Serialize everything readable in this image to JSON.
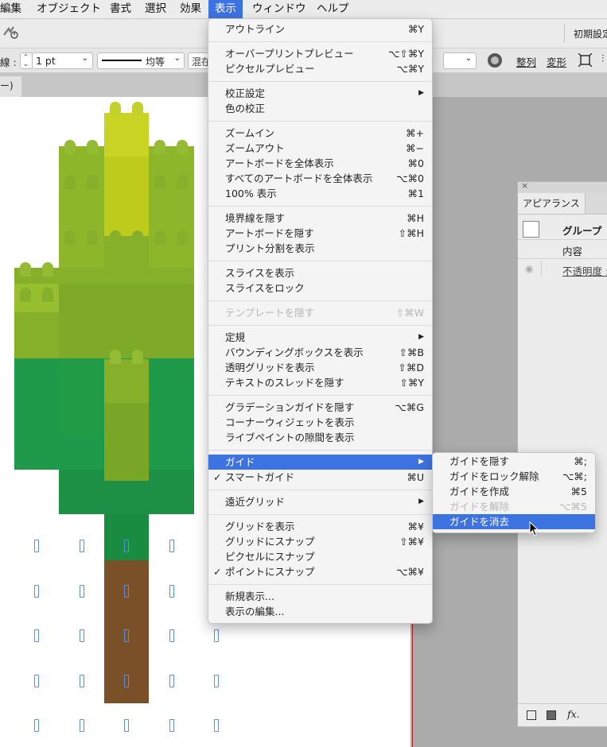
{
  "menubar": {
    "items": [
      "編集",
      "オブジェクト",
      "書式",
      "選択",
      "効果",
      "表示",
      "ウィンドウ",
      "ヘルプ"
    ],
    "active": "表示"
  },
  "toolbar": {
    "workspace_label": "初期設定",
    "stroke_label": "線 :",
    "stroke_weight": "1 pt",
    "stroke_profile": "均等",
    "blend_label": "混在",
    "align_label": "整列",
    "transform_label": "変形"
  },
  "tab": {
    "label": "ー)"
  },
  "appearance_panel": {
    "tab_label": "アピアランス",
    "group_label": "グループ",
    "content_label": "内容",
    "opacity_label": "不透明度 :",
    "fx_label": "fx."
  },
  "view_menu": {
    "items": [
      {
        "label": "アウトライン",
        "shortcut": "⌘Y"
      },
      {
        "sep": true
      },
      {
        "label": "オーバープリントプレビュー",
        "shortcut": "⌥⇧⌘Y"
      },
      {
        "label": "ピクセルプレビュー",
        "shortcut": "⌥⌘Y"
      },
      {
        "sep": true
      },
      {
        "label": "校正設定",
        "submenu": true
      },
      {
        "label": "色の校正",
        "shortcut": ""
      },
      {
        "sep": true
      },
      {
        "label": "ズームイン",
        "shortcut": "⌘+"
      },
      {
        "label": "ズームアウト",
        "shortcut": "⌘−"
      },
      {
        "label": "アートボードを全体表示",
        "shortcut": "⌘0"
      },
      {
        "label": "すべてのアートボードを全体表示",
        "shortcut": "⌥⌘0"
      },
      {
        "label": "100% 表示",
        "shortcut": "⌘1"
      },
      {
        "sep": true
      },
      {
        "label": "境界線を隠す",
        "shortcut": "⌘H"
      },
      {
        "label": "アートボードを隠す",
        "shortcut": "⇧⌘H"
      },
      {
        "label": "プリント分割を表示",
        "shortcut": ""
      },
      {
        "sep": true
      },
      {
        "label": "スライスを表示",
        "shortcut": ""
      },
      {
        "label": "スライスをロック",
        "shortcut": ""
      },
      {
        "sep": true
      },
      {
        "label": "テンプレートを隠す",
        "shortcut": "⇧⌘W",
        "disabled": true
      },
      {
        "sep": true
      },
      {
        "label": "定規",
        "submenu": true
      },
      {
        "label": "バウンディングボックスを表示",
        "shortcut": "⇧⌘B"
      },
      {
        "label": "透明グリッドを表示",
        "shortcut": "⇧⌘D"
      },
      {
        "label": "テキストのスレッドを隠す",
        "shortcut": "⇧⌘Y"
      },
      {
        "sep": true
      },
      {
        "label": "グラデーションガイドを隠す",
        "shortcut": "⌥⌘G"
      },
      {
        "label": "コーナーウィジェットを表示",
        "shortcut": ""
      },
      {
        "label": "ライブペイントの隙間を表示",
        "shortcut": ""
      },
      {
        "sep": true
      },
      {
        "label": "ガイド",
        "submenu": true,
        "highlighted": true
      },
      {
        "label": "スマートガイド",
        "shortcut": "⌘U",
        "checked": true
      },
      {
        "sep": true
      },
      {
        "label": "遠近グリッド",
        "submenu": true
      },
      {
        "sep": true
      },
      {
        "label": "グリッドを表示",
        "shortcut": "⌘¥"
      },
      {
        "label": "グリッドにスナップ",
        "shortcut": "⇧⌘¥"
      },
      {
        "label": "ピクセルにスナップ",
        "shortcut": ""
      },
      {
        "label": "ポイントにスナップ",
        "shortcut": "⌥⌘¥",
        "checked": true
      },
      {
        "sep": true
      },
      {
        "label": "新規表示...",
        "shortcut": ""
      },
      {
        "label": "表示の編集...",
        "shortcut": ""
      }
    ]
  },
  "guide_submenu": {
    "items": [
      {
        "label": "ガイドを隠す",
        "shortcut": "⌘;"
      },
      {
        "label": "ガイドをロック解除",
        "shortcut": "⌥⌘;"
      },
      {
        "label": "ガイドを作成",
        "shortcut": "⌘5"
      },
      {
        "label": "ガイドを解除",
        "shortcut": "⌥⌘5",
        "disabled": true
      },
      {
        "label": "ガイドを消去",
        "shortcut": "",
        "highlighted": true
      }
    ]
  },
  "colors": {
    "menu_highlight": "#3d73e0",
    "tree_light": "#8db62a",
    "tree_top": "#bccb1c",
    "tree_green": "#1e9a4a",
    "trunk": "#7a5028"
  }
}
